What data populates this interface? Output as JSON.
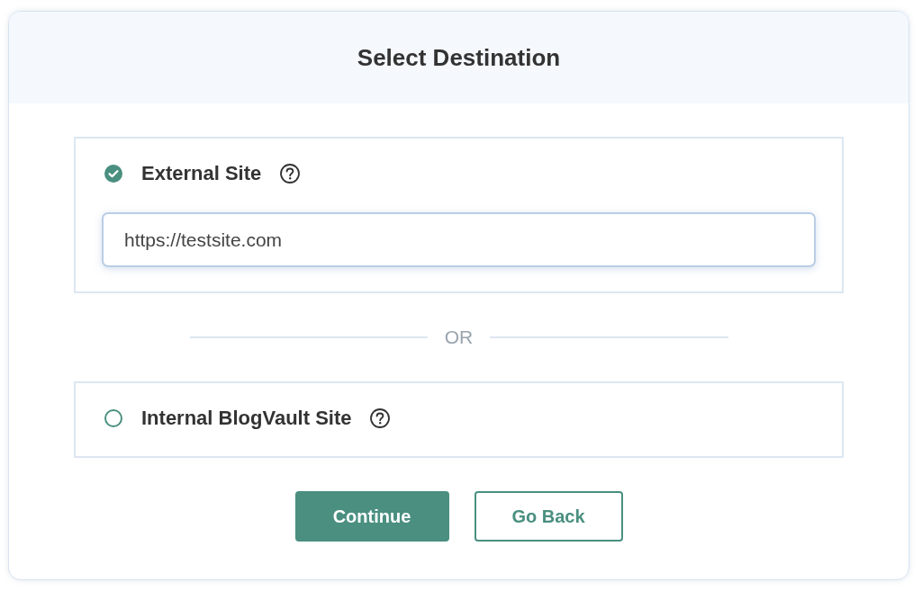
{
  "title": "Select Destination",
  "options": [
    {
      "label": "External Site",
      "selected": true,
      "input": {
        "value": "https://testsite.com"
      }
    },
    {
      "label": "Internal BlogVault Site",
      "selected": false
    }
  ],
  "divider": "OR",
  "buttons": [
    {
      "label": "Continue",
      "kind": "primary"
    },
    {
      "label": "Go Back",
      "kind": "secondary"
    }
  ]
}
